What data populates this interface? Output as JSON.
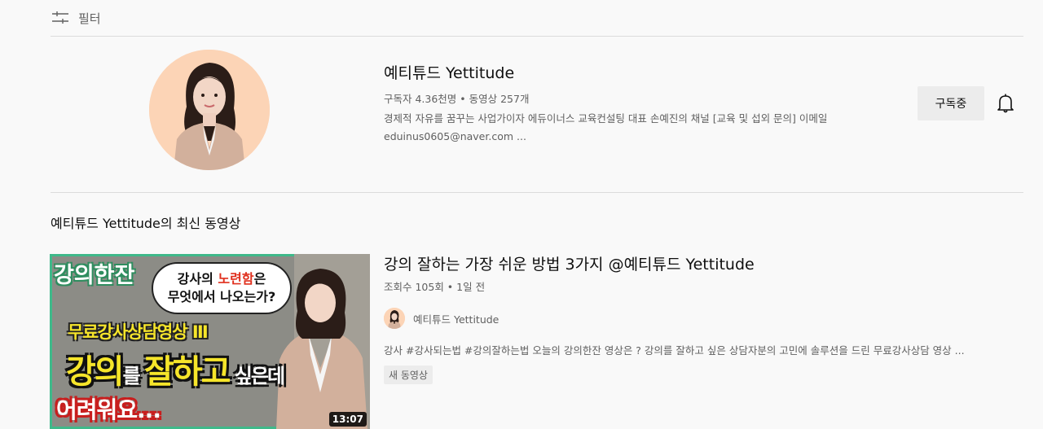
{
  "filter": {
    "label": "필터",
    "icon": "filter-sliders-icon"
  },
  "channel": {
    "name": "예티튜드 Yettitude",
    "meta": "구독자 4.36천명 • 동영상 257개",
    "description": "경제적 자유를 꿈꾸는 사업가이자 에듀이너스 교육컨설팅 대표 손예진의 채널 [교육 및 섭외 문의] 이메일 eduinus0605@naver.com ...",
    "subscribe_label": "구독중",
    "bell_icon": "bell-icon"
  },
  "section": {
    "title": "예티튜드 Yettitude의 최신 동영상"
  },
  "video": {
    "title": "강의 잘하는 가장 쉬운 방법 3가지 @예티튜드 Yettitude",
    "meta": "조회수 105회 • 1일 전",
    "channel_name": "예티튜드 Yettitude",
    "description": "강사 #강사되는법 #강의잘하는법 오늘의 강의한잔 영상은 ? 강의를 잘하고 싶은 상담자분의 고민에 솔루션을 드린 무료강사상담 영상 ...",
    "badge": "새 동영상",
    "duration": "13:07",
    "thumbnail": {
      "tag": "강의한잔",
      "bubble_pre": "강사의 ",
      "bubble_highlight": "노련함",
      "bubble_post": "은",
      "bubble_line2": "무엇에서 나오는가?",
      "line_b": "무료강사상담영상 Ⅲ",
      "line_c1": "강의",
      "line_c2": "를 ",
      "line_c3": "잘하고",
      "line_c4": " 싶은데",
      "line_d": "어려워요..."
    }
  },
  "colors": {
    "background": "#f9f9f9",
    "secondary_text": "#606060",
    "divider": "#dcdcdc",
    "button_bg": "#ececec"
  }
}
